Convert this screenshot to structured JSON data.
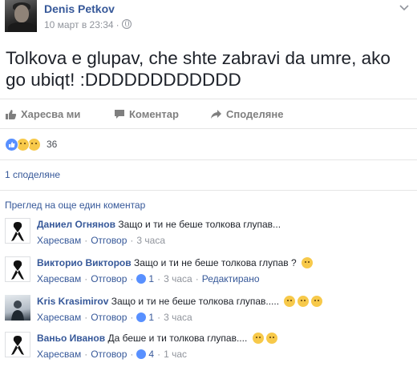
{
  "post": {
    "author": "Denis Petkov",
    "timestamp": "10 март в 23:34",
    "text": "Tolkova e glupav, che shte zabravi da umre, ako go ubiqt! :DDDDDDDDDDDD"
  },
  "actions": {
    "like": "Харесва ми",
    "comment": "Коментар",
    "share": "Споделяне"
  },
  "reactions": {
    "count": "36",
    "types": [
      "like-icon",
      "sad-icon",
      "haha-icon"
    ]
  },
  "shares_text": "1 споделяне",
  "more_comments_text": "Преглед на още един коментар",
  "comment_meta": {
    "like_label": "Харесвам",
    "reply_label": "Отговор",
    "edited_label": "Редактирано"
  },
  "comments": [
    {
      "name": "Даниел Огнянов",
      "text": "Защо и ти не беше толкова глупав...",
      "likes": "",
      "time": "3 часа",
      "avatar": "black-ribbon-icon"
    },
    {
      "name": "Викторио Викторов",
      "text": "Защо и ти не беше толкова глупав ?",
      "likes": "1",
      "time": "3 часа",
      "avatar": "black-ribbon-icon"
    },
    {
      "name": "Kris Krasimirov",
      "text": "Защо и ти не беше толкова глупав.....",
      "likes": "1",
      "time": "3 часа",
      "avatar": "photo"
    },
    {
      "name": "Ваньо Иванов",
      "text": "Да беше и ти толкова глупав....",
      "likes": "4",
      "time": "1 час",
      "avatar": "black-ribbon-icon"
    }
  ],
  "colors": {
    "link": "#365899",
    "meta": "#90949c",
    "like_blue": "#5890ff",
    "emoji_yellow": "#f7c94a"
  }
}
